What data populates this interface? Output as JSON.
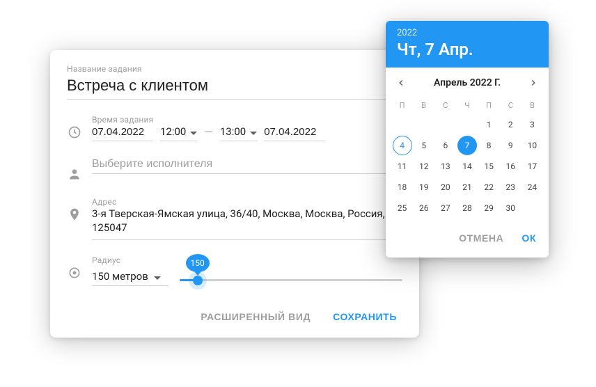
{
  "form": {
    "title_label": "Название задания",
    "title_value": "Встреча с клиентом",
    "time_label": "Время задания",
    "date_start": "07.04.2022",
    "time_start": "12:00",
    "time_end": "13:00",
    "date_end": "07.04.2022",
    "dash": "—",
    "assignee_placeholder": "Выберите исполнителя",
    "address_label": "Адрес",
    "address_value": "3-я Тверская-Ямская улица, 36/40, Москва, Москва, Россия, 125047",
    "radius_label": "Радиус",
    "radius_value": "150 метров",
    "radius_number": "150",
    "advanced_btn": "РАСШИРЕННЫЙ ВИД",
    "save_btn": "СОХРАНИТЬ"
  },
  "datepicker": {
    "year": "2022",
    "header_date": "Чт, 7 Апр.",
    "month_title": "Апрель 2022 Г.",
    "dow": [
      "П",
      "В",
      "С",
      "Ч",
      "П",
      "С",
      "В"
    ],
    "leading_blanks": 4,
    "today": 4,
    "selected": 7,
    "last_day": 30,
    "cancel": "ОТМЕНА",
    "ok": "ОК"
  }
}
